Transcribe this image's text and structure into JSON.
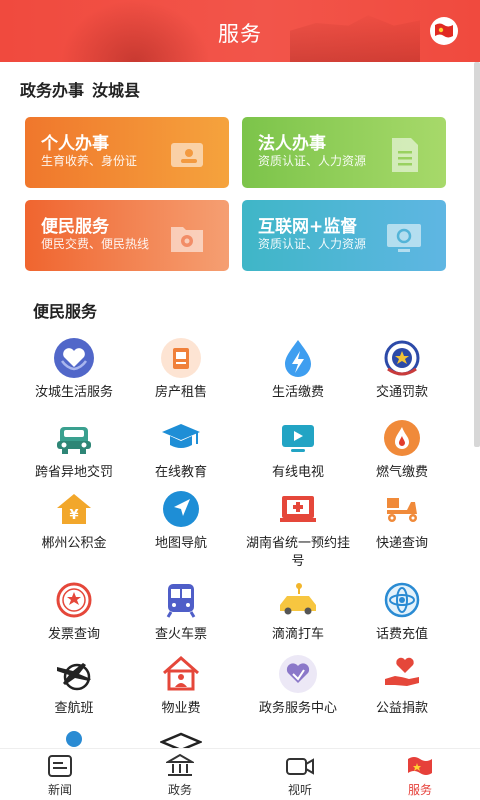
{
  "header": {
    "title": "服务"
  },
  "location": {
    "label": "政务办事",
    "county": "汝城县"
  },
  "cards": [
    {
      "title": "个人办事",
      "subtitle": "生育收养、身份证"
    },
    {
      "title": "法人办事",
      "subtitle": "资质认证、人力资源"
    },
    {
      "title": "便民服务",
      "subtitle": "便民交费、便民热线"
    },
    {
      "title": "互联网+监督",
      "subtitle": "资质认证、人力资源"
    }
  ],
  "section": {
    "title": "便民服务"
  },
  "services": [
    {
      "label": "汝城生活服务",
      "icon": "heart-hands-icon"
    },
    {
      "label": "房产租售",
      "icon": "house-document-icon"
    },
    {
      "label": "生活缴费",
      "icon": "lightning-drop-icon"
    },
    {
      "label": "交通罚款",
      "icon": "police-badge-icon"
    },
    {
      "label": "跨省异地交罚",
      "icon": "car-icon"
    },
    {
      "label": "在线教育",
      "icon": "graduation-cap-icon"
    },
    {
      "label": "有线电视",
      "icon": "tv-icon"
    },
    {
      "label": "燃气缴费",
      "icon": "flame-icon"
    },
    {
      "label": "郴州公积金",
      "icon": "house-yuan-icon"
    },
    {
      "label": "地图导航",
      "icon": "navigation-arrow-icon"
    },
    {
      "label": "湖南省统一预约挂号",
      "icon": "hospital-icon"
    },
    {
      "label": "快递查询",
      "icon": "delivery-scooter-icon"
    },
    {
      "label": "发票查询",
      "icon": "invoice-seal-icon"
    },
    {
      "label": "查火车票",
      "icon": "train-icon"
    },
    {
      "label": "滴滴打车",
      "icon": "taxi-icon"
    },
    {
      "label": "话费充值",
      "icon": "phone-charge-icon"
    },
    {
      "label": "查航班",
      "icon": "airplane-globe-icon"
    },
    {
      "label": "物业费",
      "icon": "property-house-icon"
    },
    {
      "label": "政务服务中心",
      "icon": "service-center-icon"
    },
    {
      "label": "公益捐款",
      "icon": "donation-heart-icon"
    }
  ],
  "tabs": [
    {
      "label": "新闻",
      "icon": "news-icon"
    },
    {
      "label": "政务",
      "icon": "government-icon"
    },
    {
      "label": "视听",
      "icon": "video-camera-icon"
    },
    {
      "label": "服务",
      "icon": "service-flag-icon",
      "active": true
    }
  ],
  "colors": {
    "primary": "#f04a3e",
    "active_tab": "#e6403a"
  }
}
